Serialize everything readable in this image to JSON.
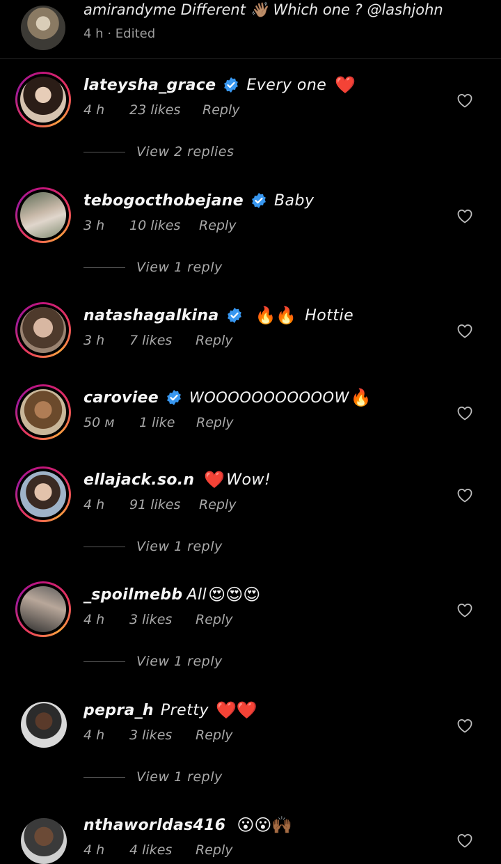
{
  "top": {
    "text": "amirandyme Different 👋🏽 Which one ? @lashjohn",
    "time": "4 h",
    "separator": "·",
    "edited": "Edited"
  },
  "colors": {
    "background": "#000000",
    "verified": "#3897f0",
    "meta": "#a8a8a8"
  },
  "comments": [
    {
      "username": "lateysha_grace",
      "verified": true,
      "text": "Every one",
      "emoji": "❤️",
      "time": "4 h",
      "likes": "23 likes",
      "reply": "Reply",
      "view_replies": "View 2 replies"
    },
    {
      "username": "tebogocthobejane",
      "verified": true,
      "text": "Baby",
      "emoji": "",
      "time": "3 h",
      "likes": "10 likes",
      "reply": "Reply",
      "view_replies": "View 1 reply"
    },
    {
      "username": "natashagalkina",
      "verified": true,
      "text": "Hottie",
      "emoji": "🔥🔥",
      "time": "3 h",
      "likes": "7 likes",
      "reply": "Reply",
      "view_replies": ""
    },
    {
      "username": "caroviee",
      "verified": true,
      "text": "WOOOOOOOOOOOW",
      "emoji": "🔥",
      "time": "50 м",
      "likes": "1 like",
      "reply": "Reply",
      "view_replies": ""
    },
    {
      "username": "ellajack.so.n",
      "verified": false,
      "text": "Wow!",
      "emoji": "❤️",
      "time": "4 h",
      "likes": "91 likes",
      "reply": "Reply",
      "view_replies": "View 1 reply"
    },
    {
      "username": "_spoilmebb",
      "verified": false,
      "text": "All",
      "emoji": "😍😍😍",
      "time": "4 h",
      "likes": "3 likes",
      "reply": "Reply",
      "view_replies": "View 1 reply"
    },
    {
      "username": "pepra_h",
      "verified": false,
      "text": "Pretty",
      "emoji": "❤️❤️",
      "time": "4 h",
      "likes": "3 likes",
      "reply": "Reply",
      "view_replies": "View 1 reply"
    },
    {
      "username": "nthaworldas416",
      "verified": false,
      "text": "",
      "emoji": "😮😮🙌🏾",
      "time": "4 h",
      "likes": "4 likes",
      "reply": "Reply",
      "view_replies": ""
    }
  ]
}
